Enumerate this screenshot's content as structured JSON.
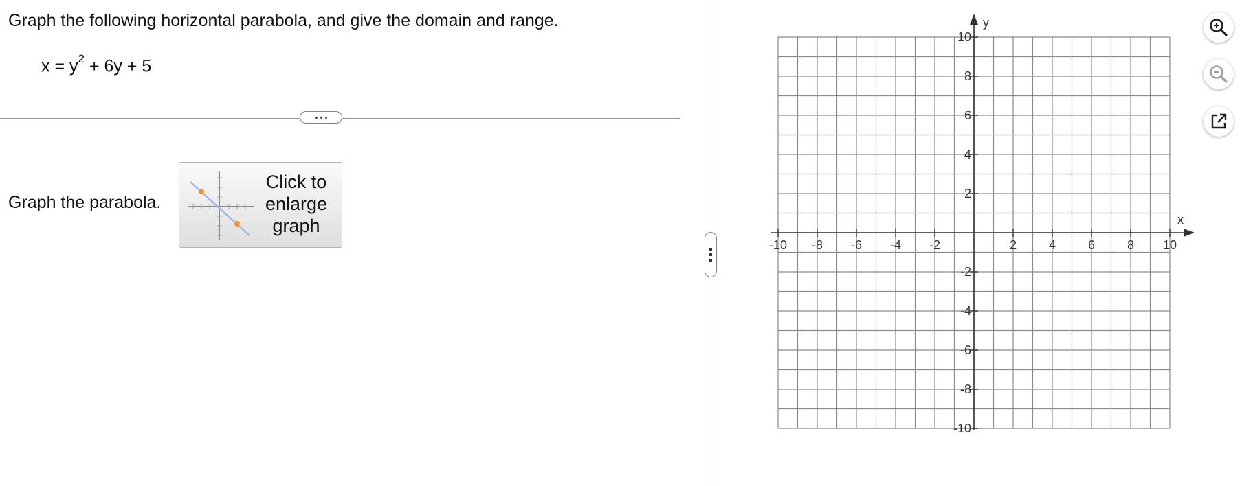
{
  "question": {
    "prompt": "Graph the following horizontal parabola, and give the domain and range.",
    "equation_lhs": "x = y",
    "equation_exponent": "2",
    "equation_rest": " + 6y + 5"
  },
  "divider": {
    "expand_icon": "ellipsis-icon"
  },
  "graph_step": {
    "instruction": "Graph the parabola.",
    "enlarge_button_lines": [
      "Click to",
      "enlarge",
      "graph"
    ],
    "thumbnail_icon": "line-graph-thumbnail-icon"
  },
  "graph": {
    "x_axis_label": "x",
    "y_axis_label": "y",
    "x_range": [
      -10,
      10
    ],
    "y_range": [
      -10,
      10
    ],
    "grid_step": 1,
    "x_tick_labels": [
      "-10",
      "-8",
      "-6",
      "-4",
      "-2",
      "2",
      "4",
      "6",
      "8",
      "10"
    ],
    "y_tick_labels": [
      "10",
      "8",
      "6",
      "4",
      "2",
      "-2",
      "-4",
      "-6",
      "-8",
      "-10"
    ],
    "grid_color": "#8a8a8a",
    "axis_color": "#333333"
  },
  "tools": {
    "zoom_in_icon": "zoom-in-icon",
    "zoom_out_icon": "zoom-out-icon",
    "popout_icon": "external-link-icon",
    "accent_color": "#1f1f1f",
    "disabled_color": "#9aa0a6"
  }
}
